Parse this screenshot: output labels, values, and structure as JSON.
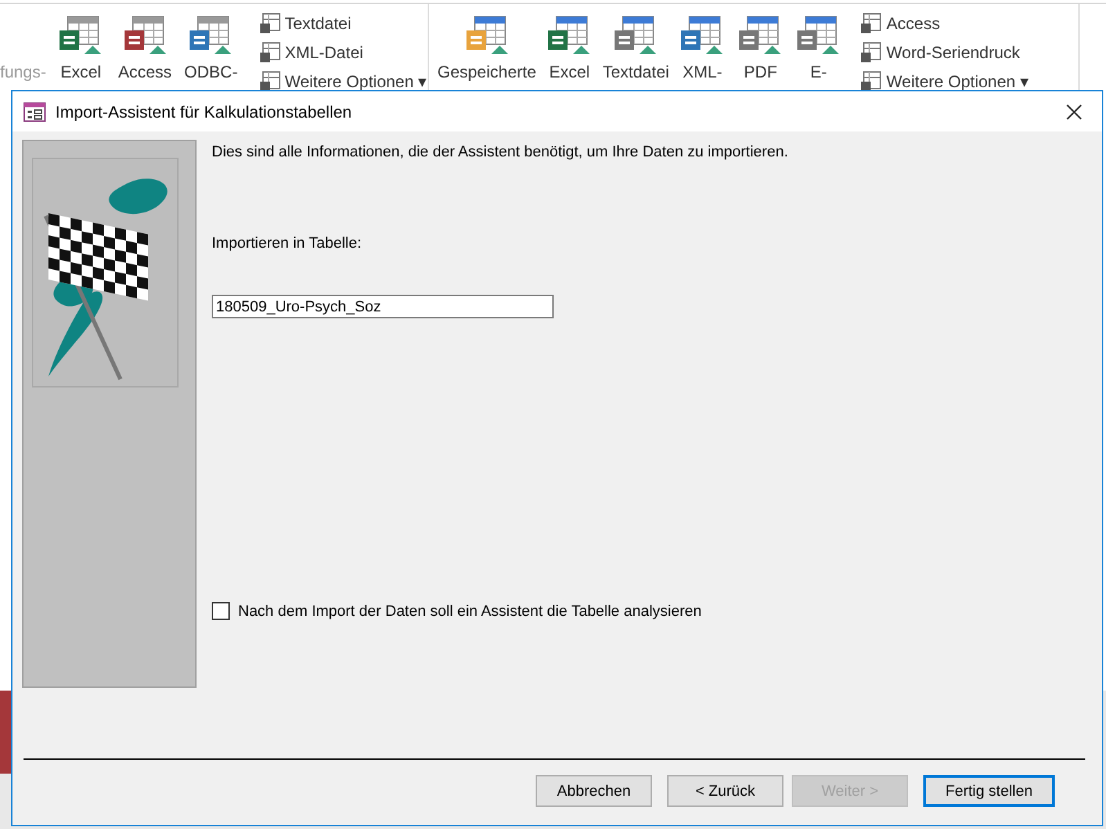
{
  "ribbon": {
    "groups": [
      {
        "items": [
          {
            "kind": "faded",
            "label": "fungs-"
          },
          {
            "kind": "large",
            "label": "Excel"
          },
          {
            "kind": "large",
            "label": "Access"
          },
          {
            "kind": "large",
            "label": "ODBC-"
          },
          {
            "kind": "column",
            "entries": [
              "Textdatei",
              "XML-Datei",
              "Weitere Optionen ▾"
            ]
          }
        ]
      },
      {
        "items": [
          {
            "kind": "large",
            "label": "Gespeicherte"
          },
          {
            "kind": "large",
            "label": "Excel"
          },
          {
            "kind": "large",
            "label": "Textdatei"
          },
          {
            "kind": "large",
            "label": "XML-"
          },
          {
            "kind": "large",
            "label": "PDF"
          },
          {
            "kind": "large",
            "label": "E-"
          },
          {
            "kind": "column",
            "entries": [
              "Access",
              "Word-Seriendruck",
              "Weitere Optionen ▾"
            ]
          }
        ]
      }
    ]
  },
  "dialog": {
    "title": "Import-Assistent für Kalkulationstabellen",
    "intro": "Dies sind alle Informationen, die der Assistent benötigt, um Ihre Daten zu importieren.",
    "table_label": "Importieren in Tabelle:",
    "table_value": "180509_Uro-Psych_Soz",
    "analyze_checkbox": {
      "label": "Nach dem Import der Daten soll ein Assistent die Tabelle analysieren",
      "checked": false
    },
    "buttons": [
      {
        "label": "Abbrechen",
        "disabled": false,
        "default": false
      },
      {
        "label": "< Zurück",
        "disabled": false,
        "default": false
      },
      {
        "label": "Weiter >",
        "disabled": true,
        "default": false
      },
      {
        "label": "Fertig stellen",
        "disabled": false,
        "default": true
      }
    ]
  }
}
